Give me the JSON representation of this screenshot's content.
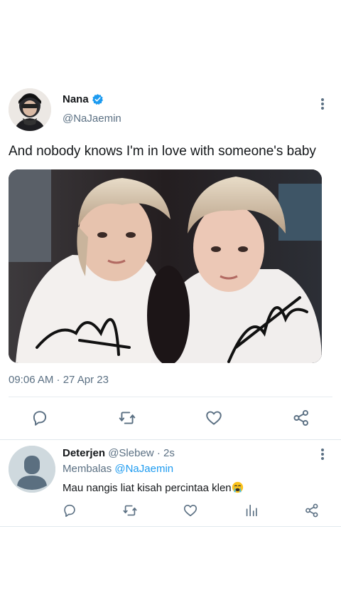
{
  "tweet": {
    "author": {
      "name": "Nana",
      "handle": "@NaJaemin",
      "verified": true
    },
    "text": "And nobody knows I'm in love with someone's baby",
    "timestamp": "09:06 AM · 27 Apr 23",
    "actions": [
      "reply-icon",
      "retweet-icon",
      "like-icon",
      "share-icon"
    ]
  },
  "reply": {
    "name": "Deterjen",
    "handle": "@Slebew",
    "time": "· 2s",
    "replying_label": "Membalas",
    "replying_to": "@NaJaemin",
    "text": "Mau nangis liat kisah percintaa klen",
    "actions": [
      "reply-icon",
      "retweet-icon",
      "like-icon",
      "analytics-icon",
      "share-icon"
    ]
  },
  "colors": {
    "text": "#14171a",
    "secondary": "#5b7083",
    "accent": "#1d9bf0",
    "divider": "#e6ecf0"
  }
}
